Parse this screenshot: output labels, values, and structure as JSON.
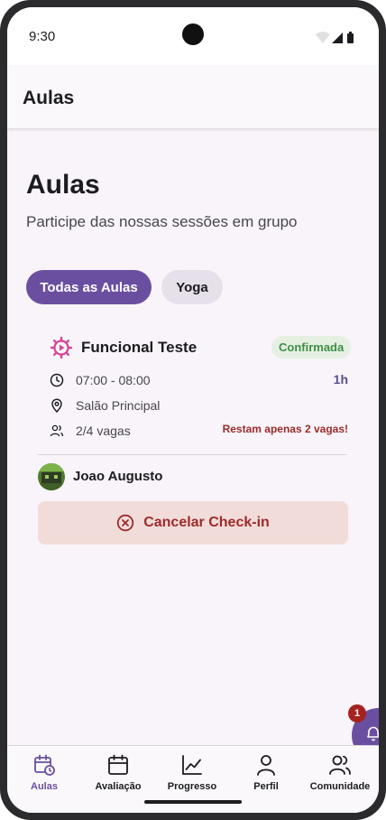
{
  "status_bar": {
    "time": "9:30"
  },
  "app_bar": {
    "title": "Aulas"
  },
  "page": {
    "title": "Aulas",
    "subtitle": "Participe das nossas sessões em grupo"
  },
  "filters": [
    {
      "label": "Todas as Aulas",
      "selected": true
    },
    {
      "label": "Yoga",
      "selected": false
    }
  ],
  "class_card": {
    "icon": "gear-play-icon",
    "name": "Funcional Teste",
    "status": "Confirmada",
    "time": "07:00 - 08:00",
    "duration": "1h",
    "location": "Salão Principal",
    "spots": "2/4 vagas",
    "spots_warning": "Restam apenas 2 vagas!",
    "participant": {
      "name": "Joao Augusto",
      "avatar": "user-avatar"
    },
    "cancel_label": "Cancelar Check-in"
  },
  "notifications": {
    "count": "1",
    "icon": "bell-icon"
  },
  "bottom_nav": [
    {
      "label": "Aulas",
      "icon": "calendar-clock-icon",
      "active": true
    },
    {
      "label": "Avaliação",
      "icon": "calendar-icon",
      "active": false
    },
    {
      "label": "Progresso",
      "icon": "chart-line-icon",
      "active": false
    },
    {
      "label": "Perfil",
      "icon": "person-icon",
      "active": false
    },
    {
      "label": "Comunidade",
      "icon": "people-icon",
      "active": false
    }
  ],
  "colors": {
    "primary": "#6a4fa1",
    "confirmed_bg": "#e5f0e3",
    "confirmed_text": "#3f8f45",
    "danger": "#9c2b2b",
    "danger_bg": "#f2dcd9",
    "background": "#f8f4f9"
  }
}
